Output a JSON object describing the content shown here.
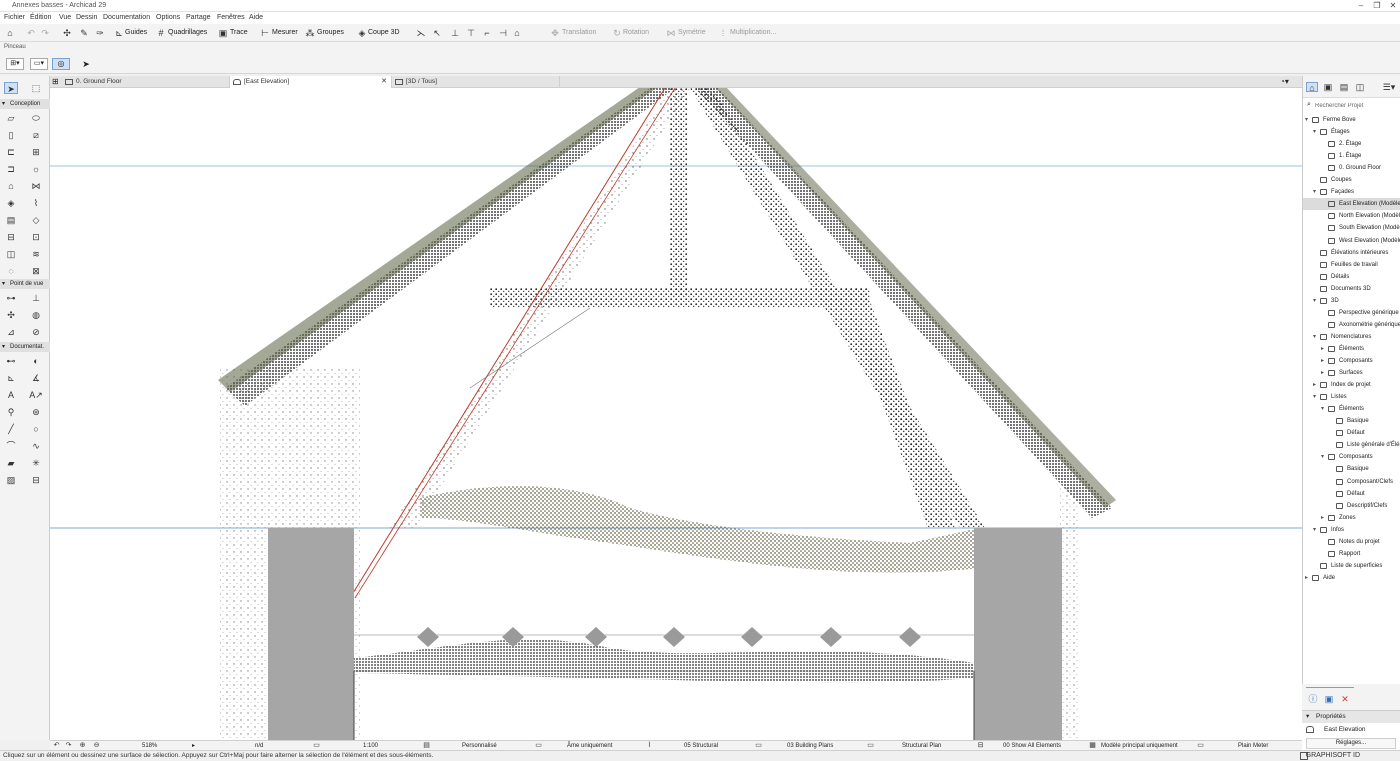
{
  "window": {
    "title": "Annexes basses - Archicad 29",
    "controls": [
      "–",
      "❐",
      "✕"
    ]
  },
  "menu": [
    "Fichier",
    "Édition",
    "Vue",
    "Dessin",
    "Documentation",
    "Options",
    "Partage",
    "Fenêtres",
    "Aide"
  ],
  "toolbar": {
    "guides": "Guides",
    "quadrillages": "Quadrillages",
    "trace": "Trace",
    "mesurer": "Mesurer",
    "groupes": "Groupes",
    "coupe3d": "Coupe 3D",
    "translation": "Translation",
    "rotation": "Rotation",
    "symetrie": "Symétrie",
    "multiplication": "Multiplication..."
  },
  "infobar": {
    "label": "Pinceau"
  },
  "tabs": [
    {
      "label": "0. Ground Floor",
      "active": false
    },
    {
      "label": "[East Elevation]",
      "active": true
    },
    {
      "label": "[3D / Tous]",
      "active": false
    }
  ],
  "toolbox": {
    "sections": [
      "Conception",
      "Point de vue",
      "Documentat."
    ]
  },
  "navigator": {
    "search_placeholder": "Rechercher Projet",
    "tree": [
      {
        "label": "Ferme Bove",
        "level": 0,
        "open": true
      },
      {
        "label": "Étages",
        "level": 1,
        "open": true
      },
      {
        "label": "2. Étage",
        "level": 2
      },
      {
        "label": "1. Étage",
        "level": 2
      },
      {
        "label": "0. Ground Floor",
        "level": 2
      },
      {
        "label": "Coupes",
        "level": 1
      },
      {
        "label": "Façades",
        "level": 1,
        "open": true
      },
      {
        "label": "East Elevation (Modèle automatique)",
        "level": 2,
        "selected": true
      },
      {
        "label": "North Elevation (Modèle automatique)",
        "level": 2
      },
      {
        "label": "South Elevation (Modèle automatique)",
        "level": 2
      },
      {
        "label": "West Elevation (Modèle automatique)",
        "level": 2
      },
      {
        "label": "Élévations intérieures",
        "level": 1
      },
      {
        "label": "Feuilles de travail",
        "level": 1
      },
      {
        "label": "Détails",
        "level": 1
      },
      {
        "label": "Documents 3D",
        "level": 1
      },
      {
        "label": "3D",
        "level": 1,
        "open": true
      },
      {
        "label": "Perspective générique",
        "level": 2
      },
      {
        "label": "Axonométrie générique",
        "level": 2
      },
      {
        "label": "Nomenclatures",
        "level": 1,
        "open": true
      },
      {
        "label": "Éléments",
        "level": 2,
        "closed": true
      },
      {
        "label": "Composants",
        "level": 2,
        "closed": true
      },
      {
        "label": "Surfaces",
        "level": 2,
        "closed": true
      },
      {
        "label": "Index de projet",
        "level": 1,
        "closed": true
      },
      {
        "label": "Listes",
        "level": 1,
        "open": true
      },
      {
        "label": "Éléments",
        "level": 2,
        "open": true
      },
      {
        "label": "Basique",
        "level": 3
      },
      {
        "label": "Défaut",
        "level": 3
      },
      {
        "label": "Liste générale d'Éléments",
        "level": 3
      },
      {
        "label": "Composants",
        "level": 2,
        "open": true
      },
      {
        "label": "Basique",
        "level": 3
      },
      {
        "label": "Composant/Clefs",
        "level": 3
      },
      {
        "label": "Défaut",
        "level": 3
      },
      {
        "label": "Descriptif/Clefs",
        "level": 3
      },
      {
        "label": "Zones",
        "level": 2,
        "closed": true
      },
      {
        "label": "Infos",
        "level": 1,
        "open": true
      },
      {
        "label": "Notes du projet",
        "level": 2
      },
      {
        "label": "Rapport",
        "level": 2
      },
      {
        "label": "Liste de superficies",
        "level": 1
      },
      {
        "label": "Aide",
        "level": 0,
        "closed": true
      }
    ]
  },
  "properties": {
    "header": "Propriétés",
    "value": "East Elevation",
    "settings_button": "Réglages..."
  },
  "statusbar": {
    "zoom": "518%",
    "angle": "n/d",
    "scale": "1:100",
    "pen_set": "Personnalisé",
    "layer_combo": "Âme uniquement",
    "structural": "05 Structural",
    "building_plans": "03 Building Plans",
    "structural_plan": "Structural Plan",
    "show_all": "00 Show All Elements",
    "model_view": "Modèle principal uniquement",
    "units": "Plain Meter"
  },
  "hint": "Cliquez sur un élément ou dessinez une surface de sélection. Appuyez sur Ctrl+Maj pour faire alterner la sélection de l'élément et des sous-éléments.",
  "brand": "GRAPHISOFT ID"
}
